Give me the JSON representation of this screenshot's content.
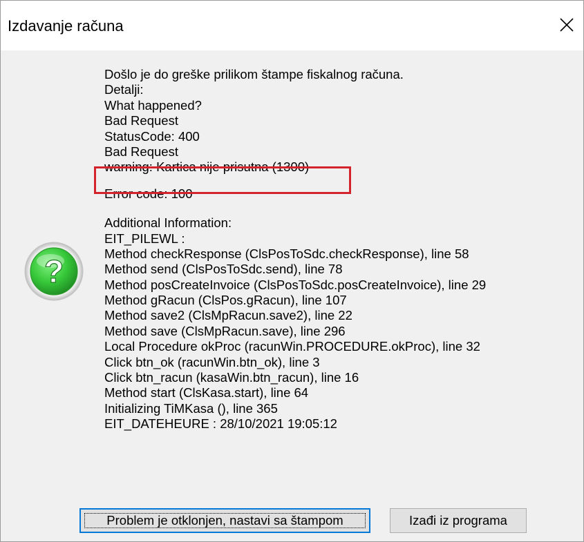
{
  "window": {
    "title": "Izdavanje računa",
    "close_icon": "close-icon"
  },
  "dialog": {
    "icon": "question-icon",
    "icon_colors": {
      "outer": "#2e9b2f",
      "inner": "#37c83a",
      "glyph": "#ffffff",
      "ring": "#d8d8d8"
    },
    "message_lines": [
      "Došlo je do greške prilikom štampe fiskalnog računa.",
      "Detalji:",
      "What happened?",
      "Bad Request",
      "StatusCode: 400",
      "Bad Request",
      "warning: Kartica nije prisutna (1300)"
    ],
    "error_code": "Error code: 100",
    "additional_lines": [
      "Additional Information:",
      "EIT_PILEWL :",
      "Method checkResponse (ClsPosToSdc.checkResponse), line 58",
      "Method send (ClsPosToSdc.send), line 78",
      "Method posCreateInvoice (ClsPosToSdc.posCreateInvoice), line 29",
      "Method gRacun (ClsPos.gRacun), line 107",
      "Method save2 (ClsMpRacun.save2), line 22",
      "Method save (ClsMpRacun.save), line 296",
      "Local Procedure okProc (racunWin.PROCEDURE.okProc), line 32",
      "Click btn_ok (racunWin.btn_ok), line 3",
      "Click btn_racun (kasaWin.btn_racun), line 16",
      "Method start (ClsKasa.start), line 64",
      "Initializing TiMKasa (), line 365",
      "EIT_DATEHEURE : 28/10/2021 19:05:12"
    ],
    "highlight_color": "#d3232c"
  },
  "buttons": {
    "continue_label": "Problem je otklonjen, nastavi sa štampom",
    "exit_label": "Izađi iz programa",
    "focus_color": "#0078d7"
  }
}
